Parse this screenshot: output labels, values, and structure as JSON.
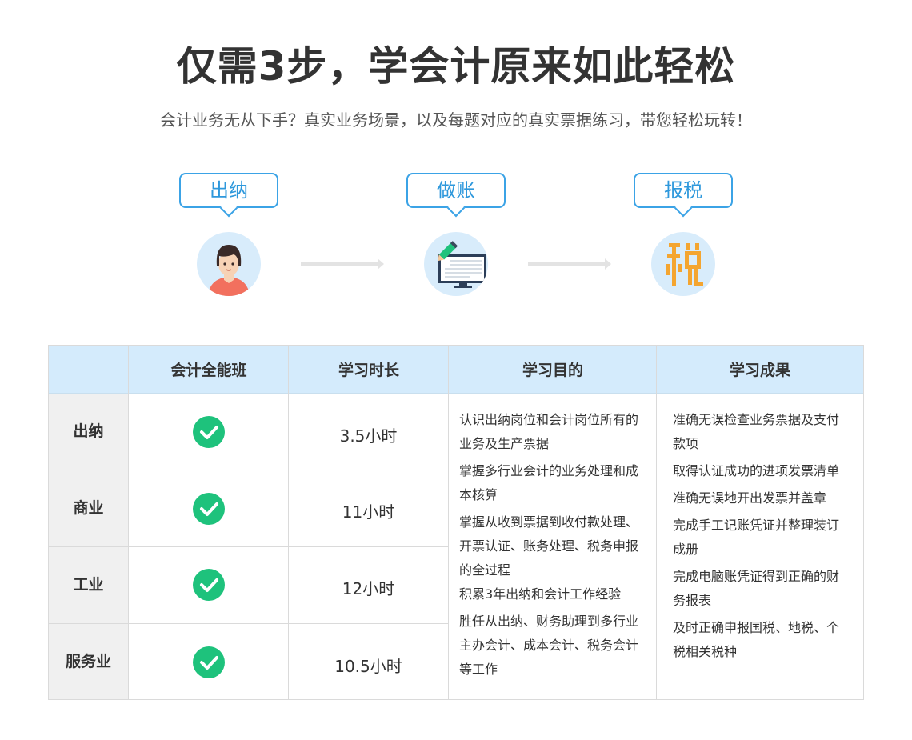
{
  "header": {
    "title": "仅需3步，学会计原来如此轻松",
    "subtitle": "会计业务无从下手？真实业务场景，以及每题对应的真实票据练习，带您轻松玩转！"
  },
  "steps": [
    {
      "label": "出纳",
      "icon": "cashier-woman-icon"
    },
    {
      "label": "做账",
      "icon": "bookkeeping-monitor-icon"
    },
    {
      "label": "报税",
      "icon": "tax-character-icon"
    }
  ],
  "table": {
    "headers": [
      "",
      "会计全能班",
      "学习时长",
      "学习目的",
      "学习成果"
    ],
    "rows": [
      {
        "label": "出纳",
        "included": true,
        "duration": "3.5小时"
      },
      {
        "label": "商业",
        "included": true,
        "duration": "11小时"
      },
      {
        "label": "工业",
        "included": true,
        "duration": "12小时"
      },
      {
        "label": "服务业",
        "included": true,
        "duration": "10.5小时"
      }
    ],
    "goals": [
      "认识出纳岗位和会计岗位所有的业务及生产票据",
      "掌握多行业会计的业务处理和成本核算",
      "掌握从收到票据到收付款处理、开票认证、账务处理、税务申报的全过程",
      "积累3年出纳和会计工作经验",
      "胜任从出纳、财务助理到多行业主办会计、成本会计、税务会计等工作"
    ],
    "outcomes": [
      "准确无误检查业务票据及支付款项",
      "取得认证成功的进项发票清单",
      "准确无误地开出发票并盖章",
      "完成手工记账凭证并整理装订成册",
      "完成电脑账凭证得到正确的财务报表",
      "及时正确申报国税、地税、个税相关税种"
    ]
  },
  "colors": {
    "accent_blue": "#3ba3e6",
    "header_bg": "#d4ebfc",
    "check_green": "#1ec27c",
    "row_label_bg": "#f0f0f0"
  }
}
